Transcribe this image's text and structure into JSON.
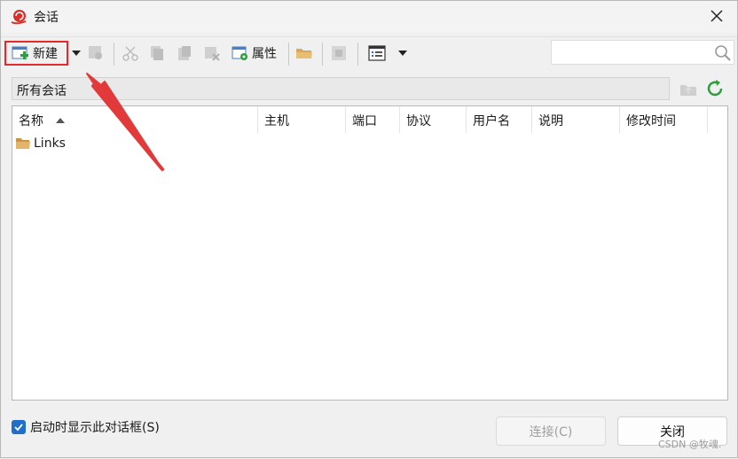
{
  "window": {
    "title": "会话"
  },
  "toolbar": {
    "new_label": "新建",
    "properties_label": "属性"
  },
  "search": {
    "value": "",
    "placeholder": ""
  },
  "path": {
    "label": "所有会话"
  },
  "list": {
    "columns": [
      "名称",
      "主机",
      "端口",
      "协议",
      "用户名",
      "说明",
      "修改时间"
    ],
    "sort_column": "名称",
    "sort_direction": "ascending",
    "rows": [
      {
        "name": "Links",
        "type": "folder"
      }
    ]
  },
  "footer": {
    "show_on_startup_label": "启动时显示此对话框(S)",
    "show_on_startup_checked": true,
    "connect_label": "连接(C)",
    "close_label": "关闭",
    "watermark": "CSDN @牧魂."
  },
  "colors": {
    "highlight_red": "#e32a2a",
    "checkbox_blue": "#1f6ec7",
    "folder": "#d9a85a",
    "refresh_green": "#2e9e3a"
  }
}
